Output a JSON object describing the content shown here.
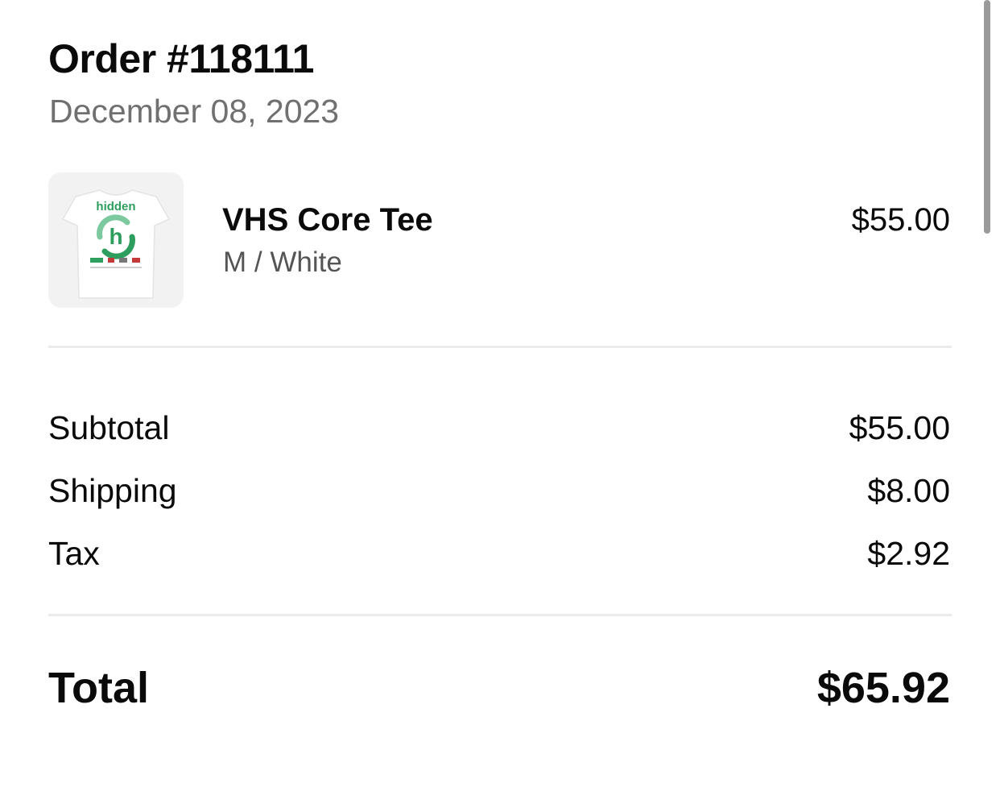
{
  "order": {
    "title": "Order #118111",
    "date": "December 08, 2023"
  },
  "item": {
    "name": "VHS Core Tee",
    "variant": "M / White",
    "price": "$55.00",
    "image_brand_text": "hidden",
    "image_icon": "tshirt-product-image"
  },
  "summary": {
    "subtotal_label": "Subtotal",
    "subtotal_value": "$55.00",
    "shipping_label": "Shipping",
    "shipping_value": "$8.00",
    "tax_label": "Tax",
    "tax_value": "$2.92"
  },
  "total": {
    "label": "Total",
    "value": "$65.92"
  },
  "colors": {
    "text": "#0a0a0a",
    "muted": "#707070",
    "divider": "#ebebeb",
    "brand_green": "#2e9e5e"
  }
}
